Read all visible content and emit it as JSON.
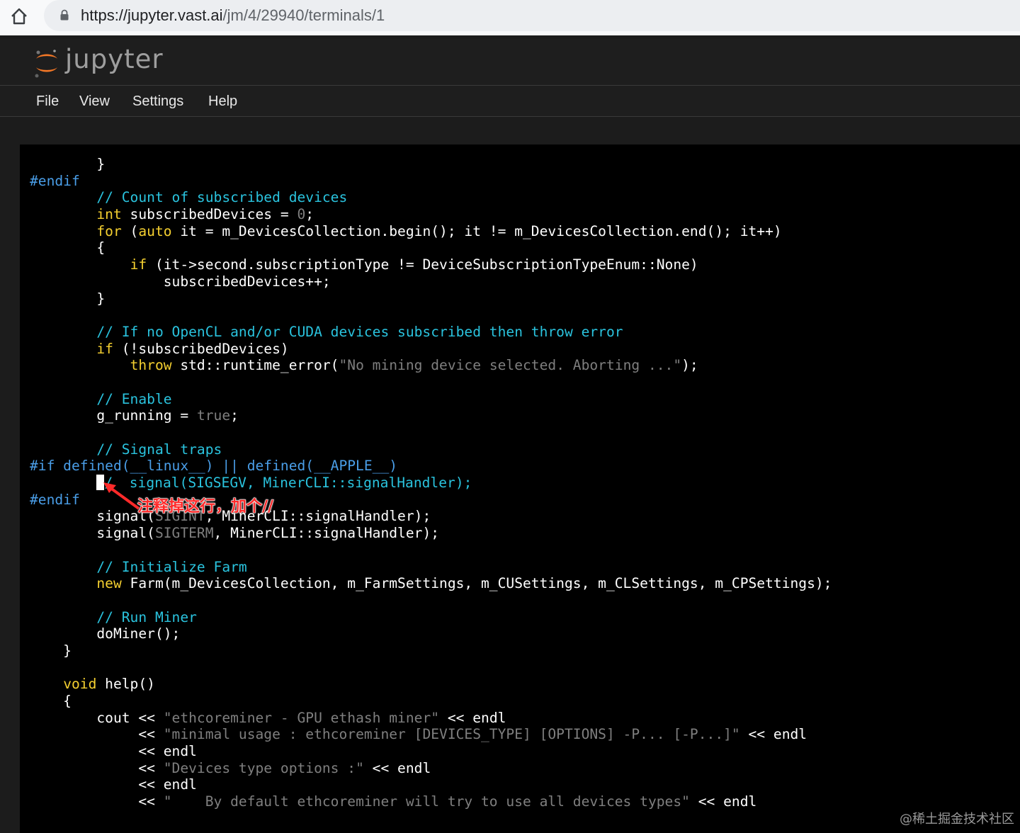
{
  "browser": {
    "url_main": "https://jupyter.vast.ai",
    "url_path": "/jm/4/29940/terminals/1"
  },
  "app": {
    "logo_text": "jupyter"
  },
  "menu": {
    "file": "File",
    "view": "View",
    "settings": "Settings",
    "help": "Help"
  },
  "code": [
    [
      {
        "t": "        }"
      }
    ],
    [
      {
        "t": "#endif",
        "c": "pp"
      }
    ],
    [
      {
        "t": "        "
      },
      {
        "t": "// Count of subscribed devices",
        "c": "cm"
      }
    ],
    [
      {
        "t": "        "
      },
      {
        "t": "int",
        "c": "kw"
      },
      {
        "t": " subscribedDevices = "
      },
      {
        "t": "0",
        "c": "str"
      },
      {
        "t": ";"
      }
    ],
    [
      {
        "t": "        "
      },
      {
        "t": "for",
        "c": "kw"
      },
      {
        "t": " ("
      },
      {
        "t": "auto",
        "c": "kw"
      },
      {
        "t": " it = m_DevicesCollection.begin(); it != m_DevicesCollection.end(); it++)"
      }
    ],
    [
      {
        "t": "        {"
      }
    ],
    [
      {
        "t": "            "
      },
      {
        "t": "if",
        "c": "kw"
      },
      {
        "t": " (it->second.subscriptionType != DeviceSubscriptionTypeEnum::None)"
      }
    ],
    [
      {
        "t": "                subscribedDevices++;"
      }
    ],
    [
      {
        "t": "        }"
      }
    ],
    [
      {
        "t": ""
      }
    ],
    [
      {
        "t": "        "
      },
      {
        "t": "// If no OpenCL and/or CUDA devices subscribed then throw error",
        "c": "cm"
      }
    ],
    [
      {
        "t": "        "
      },
      {
        "t": "if",
        "c": "kw"
      },
      {
        "t": " (!subscribedDevices)"
      }
    ],
    [
      {
        "t": "            "
      },
      {
        "t": "throw",
        "c": "kw"
      },
      {
        "t": " std::runtime_error("
      },
      {
        "t": "\"No mining device selected. Aborting ...\"",
        "c": "str"
      },
      {
        "t": ");"
      }
    ],
    [
      {
        "t": ""
      }
    ],
    [
      {
        "t": "        "
      },
      {
        "t": "// Enable",
        "c": "cm"
      }
    ],
    [
      {
        "t": "        g_running = "
      },
      {
        "t": "true",
        "c": "str"
      },
      {
        "t": ";"
      }
    ],
    [
      {
        "t": ""
      }
    ],
    [
      {
        "t": "        "
      },
      {
        "t": "// Signal traps",
        "c": "cm"
      }
    ],
    [
      {
        "t": "#if defined(__linux__) || defined(__APPLE__)",
        "c": "pp"
      }
    ],
    [
      {
        "t": "        "
      },
      {
        "t": "",
        "c": "cursor"
      },
      {
        "t": "/  signal(SIGSEGV, MinerCLI::signalHandler);",
        "c": "cm"
      }
    ],
    [
      {
        "t": "#endif",
        "c": "pp"
      }
    ],
    [
      {
        "t": "        signal("
      },
      {
        "t": "SIGINT",
        "c": "str"
      },
      {
        "t": ", MinerCLI::signalHandler);"
      }
    ],
    [
      {
        "t": "        signal("
      },
      {
        "t": "SIGTERM",
        "c": "str"
      },
      {
        "t": ", MinerCLI::signalHandler);"
      }
    ],
    [
      {
        "t": ""
      }
    ],
    [
      {
        "t": "        "
      },
      {
        "t": "// Initialize Farm",
        "c": "cm"
      }
    ],
    [
      {
        "t": "        "
      },
      {
        "t": "new",
        "c": "kw"
      },
      {
        "t": " Farm(m_DevicesCollection, m_FarmSettings, m_CUSettings, m_CLSettings, m_CPSettings);"
      }
    ],
    [
      {
        "t": ""
      }
    ],
    [
      {
        "t": "        "
      },
      {
        "t": "// Run Miner",
        "c": "cm"
      }
    ],
    [
      {
        "t": "        doMiner();"
      }
    ],
    [
      {
        "t": "    }"
      }
    ],
    [
      {
        "t": ""
      }
    ],
    [
      {
        "t": "    "
      },
      {
        "t": "void",
        "c": "kw"
      },
      {
        "t": " help()"
      }
    ],
    [
      {
        "t": "    {"
      }
    ],
    [
      {
        "t": "        cout << "
      },
      {
        "t": "\"ethcoreminer - GPU ethash miner\"",
        "c": "str"
      },
      {
        "t": " << endl"
      }
    ],
    [
      {
        "t": "             << "
      },
      {
        "t": "\"minimal usage : ethcoreminer [DEVICES_TYPE] [OPTIONS] -P... [-P...]\"",
        "c": "str"
      },
      {
        "t": " << endl"
      }
    ],
    [
      {
        "t": "             << endl"
      }
    ],
    [
      {
        "t": "             << "
      },
      {
        "t": "\"Devices type options :\"",
        "c": "str"
      },
      {
        "t": " << endl"
      }
    ],
    [
      {
        "t": "             << endl"
      }
    ],
    [
      {
        "t": "             << "
      },
      {
        "t": "\"    By default ethcoreminer will try to use all devices types\"",
        "c": "str"
      },
      {
        "t": " << endl"
      }
    ]
  ],
  "annotation": {
    "text": "注释掉这行，加个//",
    "color": "#ff2a2a"
  },
  "watermark": "@稀土掘金技术社区",
  "colors": {
    "keyword": "#f5d030",
    "comment": "#2ac3de",
    "string": "#7f7f7f",
    "preprocessor": "#4a9ee8"
  }
}
